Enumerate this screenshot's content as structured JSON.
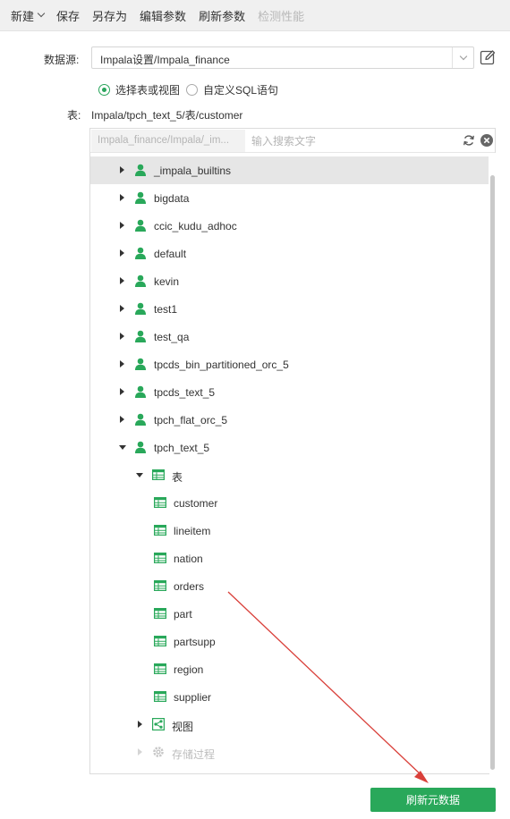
{
  "toolbar": {
    "new_label": "新建",
    "save_label": "保存",
    "save_as_label": "另存为",
    "edit_params_label": "编辑参数",
    "refresh_params_label": "刷新参数",
    "check_perf_label": "检测性能"
  },
  "datasource": {
    "label": "数据源:",
    "value": "Impala设置/Impala_finance"
  },
  "mode": {
    "option1": "选择表或视图",
    "option2": "自定义SQL语句",
    "selected": "option1"
  },
  "table": {
    "label": "表:",
    "value": "Impala/tpch_text_5/表/customer"
  },
  "search": {
    "path": "Impala_finance/Impala/_im...",
    "placeholder": "输入搜索文字"
  },
  "tree": {
    "databases": [
      "_impala_builtins",
      "bigdata",
      "ccic_kudu_adhoc",
      "default",
      "kevin",
      "test1",
      "test_qa",
      "tpcds_bin_partitioned_orc_5",
      "tpcds_text_5",
      "tpch_flat_orc_5",
      "tpch_text_5"
    ],
    "tables_folder": "表",
    "tables": [
      "customer",
      "lineitem",
      "nation",
      "orders",
      "part",
      "partsupp",
      "region",
      "supplier"
    ],
    "views_folder": "视图",
    "procs_folder": "存储过程"
  },
  "refresh_metadata_label": "刷新元数据",
  "colors": {
    "accent": "#29a85a",
    "arrow": "#d9403a"
  }
}
